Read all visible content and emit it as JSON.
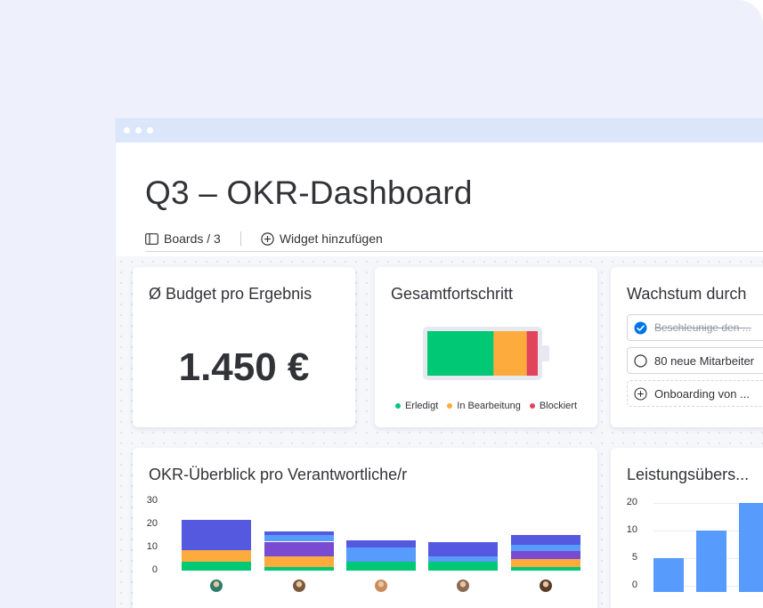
{
  "window": {
    "title": "Q3 – OKR-Dashboard"
  },
  "toolbar": {
    "boards_label": "Boards / 3",
    "add_widget_label": "Widget hinzufügen"
  },
  "widgets": {
    "budget": {
      "title": "Ø Budget pro Ergebnis",
      "value": "1.450 €"
    },
    "progress": {
      "title": "Gesamtfortschritt",
      "segments": [
        {
          "label": "Erledigt",
          "fraction": 0.6,
          "color": "#00c875"
        },
        {
          "label": "In Bearbeitung",
          "fraction": 0.3,
          "color": "#fdab3d"
        },
        {
          "label": "Blockiert",
          "fraction": 0.1,
          "color": "#e2445c"
        }
      ]
    },
    "growth": {
      "title": "Wachstum durch",
      "items": [
        {
          "label": "Beschleunige den ...",
          "checked": true
        },
        {
          "label": "80 neue Mitarbeiter",
          "checked": false
        },
        {
          "label": "Onboarding von ...",
          "add": true
        }
      ]
    },
    "okr_overview": {
      "title": "OKR-Überblick pro Verantwortliche/r"
    },
    "performance": {
      "title": "Leistungsübers..."
    }
  },
  "chart_data": [
    {
      "type": "bar",
      "stacked": true,
      "yticks": [
        "30",
        "20",
        "10",
        "0"
      ],
      "ylim": [
        0,
        30
      ],
      "categories": [
        "person-1",
        "person-2",
        "person-3",
        "person-4",
        "person-5"
      ],
      "series": [
        {
          "color": "#00c875",
          "values": [
            4,
            1.5,
            4,
            4,
            1.5
          ]
        },
        {
          "color": "#fdab3d",
          "values": [
            5,
            4.5,
            0,
            0,
            3.5
          ]
        },
        {
          "color": "#784bd1",
          "values": [
            0,
            6.5,
            0,
            0,
            3.5
          ]
        },
        {
          "color": "#579bfc",
          "values": [
            0,
            3,
            6,
            2,
            2.5
          ]
        },
        {
          "color": "#5559df",
          "values": [
            13,
            1.5,
            3,
            6.5,
            4.5
          ]
        }
      ]
    },
    {
      "type": "bar",
      "yticks": [
        "20",
        "10",
        "5",
        "0"
      ],
      "ylim": [
        0,
        20
      ],
      "values": [
        5,
        10,
        20
      ],
      "color": "#579bfc"
    }
  ]
}
